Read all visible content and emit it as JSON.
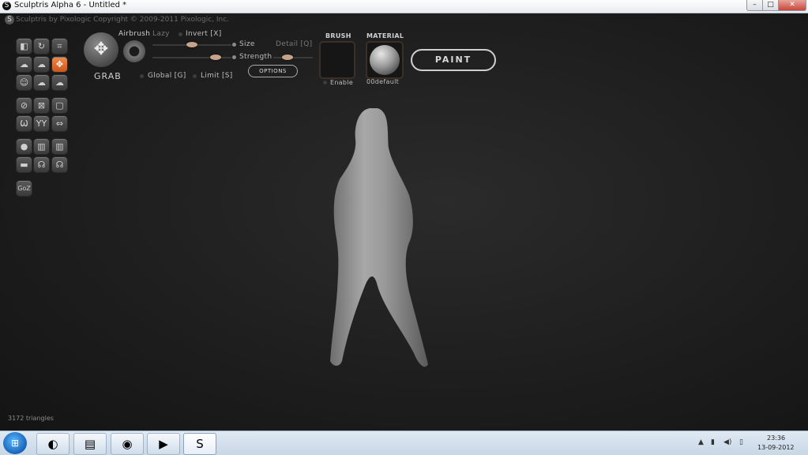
{
  "window": {
    "title": "Sculptris Alpha 6 - Untitled *",
    "controls": {
      "minimize": "–",
      "maximize": "□",
      "close": "✕"
    }
  },
  "header": {
    "copyright": "Sculptris by Pixologic   Copyright © 2009-2011 Pixologic, Inc."
  },
  "brush": {
    "tool_name": "GRAB",
    "airbrush_label": "Airbrush",
    "lazy_label": "Lazy",
    "invert_label": "Invert [X]",
    "size_label": "Size",
    "strength_label": "Strength",
    "detail_label": "Detail [Q]",
    "global_label": "Global [G]",
    "limit_label": "Limit [S]",
    "options_label": "OPTIONS",
    "size_level": 0.5,
    "strength_level": 0.85
  },
  "brush_panel": {
    "heading": "BRUSH",
    "enable_label": "Enable"
  },
  "material_panel": {
    "heading": "MATERIAL",
    "name": "00default"
  },
  "paint_button": "PAINT",
  "toolbox": {
    "icons": [
      "draw-icon",
      "rotate-icon",
      "crop-icon",
      "inflate-icon",
      "crease-icon",
      "grab-icon",
      "smooth-icon",
      "flatten-icon",
      "pinch-icon",
      "reduce-icon",
      "mask-icon",
      "scale-icon",
      "symmetry-icon",
      "mirror-icon",
      "axis-icon",
      "sphere-icon",
      "plane-icon",
      "subdivide-icon",
      "reduce-all-icon",
      "invert-icon",
      "box-icon"
    ],
    "goz_label": "GoZ",
    "tool_glyphs": [
      "◧",
      "↻",
      "⌗",
      "☁",
      "☁",
      "✥",
      "☺",
      "☁",
      "☁",
      "⊘",
      "⊠",
      "▢",
      "Ѡ",
      "YY",
      "⇔",
      "●",
      "▥",
      "▥",
      "▬",
      "☊",
      "☊"
    ]
  },
  "status": {
    "triangles": "3172 triangles"
  },
  "taskbar": {
    "apps": [
      {
        "name": "chrome-canary",
        "glyph": "◐"
      },
      {
        "name": "file-explorer",
        "glyph": "▤"
      },
      {
        "name": "chrome",
        "glyph": "◉"
      },
      {
        "name": "media-player",
        "glyph": "▶"
      },
      {
        "name": "sculptris",
        "glyph": "S"
      }
    ],
    "clock_time": "23:36",
    "clock_date": "13-09-2012",
    "tray": [
      "▲",
      "▮",
      "◀)",
      "▯"
    ]
  },
  "colors": {
    "accent": "#e2793a",
    "knob": "#c7a38c",
    "background": "#1e1e1e"
  }
}
